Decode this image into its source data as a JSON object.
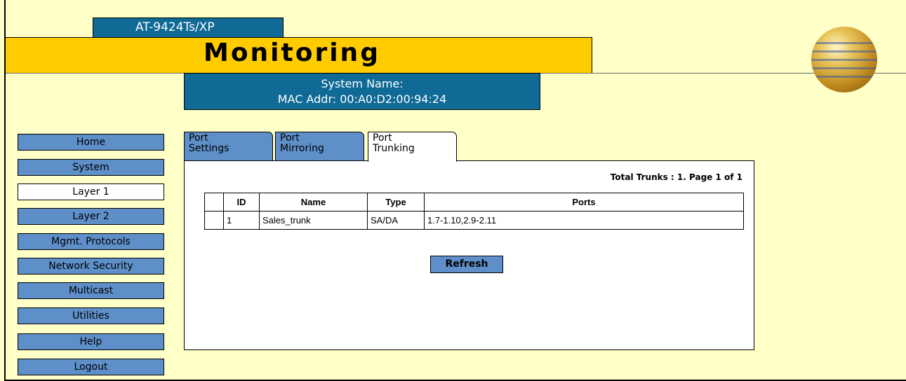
{
  "header": {
    "model": "AT-9424Ts/XP",
    "title": "Monitoring",
    "system_name": "System Name:",
    "mac_addr": "MAC Addr: 00:A0:D2:00:94:24",
    "logo_icon": "globe-logo-icon"
  },
  "colors": {
    "background": "#FFFFC8",
    "title_bar": "#FFCC00",
    "header_blue": "#0F6A96",
    "nav_blue": "#5E8FC9"
  },
  "nav": {
    "active": "Layer 1",
    "items": [
      {
        "label": "Home"
      },
      {
        "label": "System"
      },
      {
        "label": "Layer 1"
      },
      {
        "label": "Layer 2"
      },
      {
        "label": "Mgmt. Protocols"
      },
      {
        "label": "Network Security"
      },
      {
        "label": "Multicast"
      },
      {
        "label": "Utilities"
      },
      {
        "label": "Help"
      },
      {
        "label": "Logout"
      }
    ]
  },
  "tabs": [
    {
      "line1": "Port",
      "line2": "Settings"
    },
    {
      "line1": "Port",
      "line2": "Mirroring"
    },
    {
      "line1": "Port",
      "line2": "Trunking"
    }
  ],
  "active_tab": "Port Trunking",
  "trunks": {
    "total_text": "Total Trunks : 1. Page 1 of 1",
    "columns": [
      "ID",
      "Name",
      "Type",
      "Ports"
    ],
    "rows": [
      {
        "id": "1",
        "name": "Sales_trunk",
        "type": "SA/DA",
        "ports": "1.7-1.10,2.9-2.11"
      }
    ],
    "refresh_label": "Refresh"
  }
}
